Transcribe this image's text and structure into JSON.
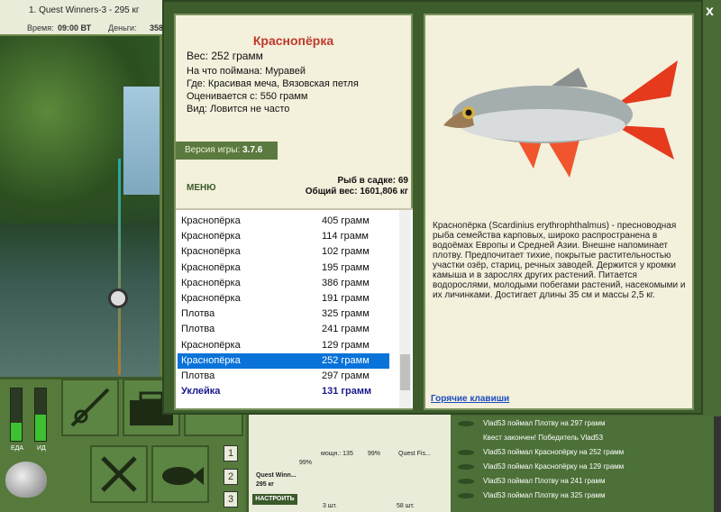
{
  "topbar": {
    "title": "1. Quest Winners-3 - 295 кг",
    "time_label": "Время:",
    "time_value": "09:00 ВТ",
    "money_label": "Деньги:",
    "money_value": "358"
  },
  "meters": {
    "food_label": "ЕДА",
    "energy_label": "ИД",
    "food_level": 0.35,
    "energy_level": 0.5
  },
  "numbers": [
    "1",
    "2",
    "3"
  ],
  "tackle": {
    "pct_1": "99%",
    "reel_label": "мощн.: 135",
    "pct_2": "99%",
    "line_label": "Quest Fis...",
    "set_name": "Quest Winn...",
    "set_weight": "295 кг",
    "setup_button": "НАСТРОИТЬ",
    "hooks_count": "3 шт.",
    "bait_count": "58 шт."
  },
  "chat": {
    "lines": [
      "Vlad53 поймал Плотву на 297 грамм",
      "Квест закончен! Победитель Vlad53",
      "Vlad53 поймал Краснопёрку на 252 грамм",
      "Vlad53 поймал Краснопёрку на 129 грамм",
      "Vlad53 поймал Плотву на 241 грамм",
      "Vlad53 поймал Плотву на 325 грамм"
    ]
  },
  "dialog": {
    "close": "x",
    "fish_name": "Краснопёрка",
    "weight": "Вес: 252 грамм",
    "caught_on": "На что поймана: Муравей",
    "location": "Где: Красивая меча, Вязовская петля",
    "valued_from": "Оценивается с: 550 грамм",
    "kind": "Вид: Ловится не часто",
    "version_label": "Версия игры:",
    "version_value": "3.7.6",
    "menu_label": "МЕНЮ",
    "cage_count": "Рыб в садке: 69",
    "total_weight": "Общий вес: 1601,806 кг",
    "catches": [
      {
        "name": "Краснопёрка",
        "weight": "405 грамм"
      },
      {
        "name": "Краснопёрка",
        "weight": "114 грамм"
      },
      {
        "name": "Краснопёрка",
        "weight": "102 грамм"
      },
      {
        "name": "Краснопёрка",
        "weight": "195 грамм"
      },
      {
        "name": "Краснопёрка",
        "weight": "386 грамм"
      },
      {
        "name": "Краснопёрка",
        "weight": "191 грамм"
      },
      {
        "name": "Плотва",
        "weight": "325 грамм"
      },
      {
        "name": "Плотва",
        "weight": "241 грамм"
      },
      {
        "name": "Краснопёрка",
        "weight": "129 грамм"
      },
      {
        "name": "Краснопёрка",
        "weight": "252 грамм"
      },
      {
        "name": "Плотва",
        "weight": "297 грамм"
      },
      {
        "name": "Уклейка",
        "weight": "131 грамм"
      }
    ],
    "description": "Краснопёрка (Scardinius erythrophthalmus) - пресноводная рыба семейства карповых, широко распространена в водоёмах Европы и Средней Азии. Внешне напоминает плотву. Предпочитает тихие, покрытые растительностью участки озёр, стариц, речных заводей. Держится у кромки камыша и в зарослях других растений. Питается водорослями, молодыми побегами растений, насекомыми и их личинками. Достигает длины 35 см и массы 2,5 кг.",
    "hotkeys": "Горячие клавиши"
  },
  "colors": {
    "title_red": "#c0392b",
    "selection_blue": "#0a73d9",
    "panel_bg": "#f3f0dc",
    "green_frame": "#3d5e2c"
  }
}
